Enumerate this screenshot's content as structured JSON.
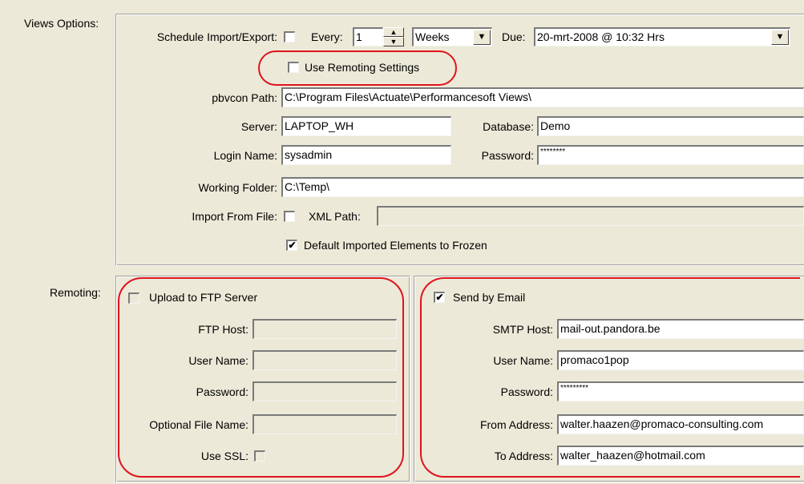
{
  "views_options": {
    "section_label": "Views Options:",
    "schedule_label": "Schedule Import/Export:",
    "schedule_checked": false,
    "every_label": "Every:",
    "every_value": "1",
    "interval_unit": "Weeks",
    "due_label": "Due:",
    "due_value": "20-mrt-2008 @ 10:32 Hrs",
    "use_remoting_label": "Use Remoting Settings",
    "use_remoting_checked": false,
    "pbvcon_label": "pbvcon Path:",
    "pbvcon_value": "C:\\Program Files\\Actuate\\Performancesoft Views\\",
    "server_label": "Server:",
    "server_value": "LAPTOP_WH",
    "database_label": "Database:",
    "database_value": "Demo",
    "login_label": "Login Name:",
    "login_value": "sysadmin",
    "password_label": "Password:",
    "password_value": "********",
    "working_folder_label": "Working Folder:",
    "working_folder_value": "C:\\Temp\\",
    "import_from_file_label": "Import From File:",
    "import_from_file_checked": false,
    "xml_path_label": "XML Path:",
    "xml_path_value": "",
    "default_frozen_label": "Default Imported Elements to Frozen",
    "default_frozen_checked": true
  },
  "remoting": {
    "section_label": "Remoting:",
    "ftp": {
      "upload_label": "Upload to FTP Server",
      "upload_checked": false,
      "host_label": "FTP Host:",
      "user_label": "User Name:",
      "password_label": "Password:",
      "optional_file_label": "Optional File Name:",
      "ssl_label": "Use SSL:",
      "ssl_checked": false
    },
    "email": {
      "send_label": "Send by Email",
      "send_checked": true,
      "smtp_label": "SMTP Host:",
      "smtp_value": "mail-out.pandora.be",
      "user_label": "User Name:",
      "user_value": "promaco1pop",
      "password_label": "Password:",
      "password_value": "*********",
      "from_label": "From Address:",
      "from_value": "walter.haazen@promaco-consulting.com",
      "to_label": "To Address:",
      "to_value": "walter_haazen@hotmail.com"
    }
  },
  "glyphs": {
    "check": "✔",
    "dropdown": "▼",
    "spin_up": "▲",
    "spin_down": "▼"
  },
  "colors": {
    "window_bg": "#ece9d8",
    "annotation_red": "#e0121c"
  }
}
